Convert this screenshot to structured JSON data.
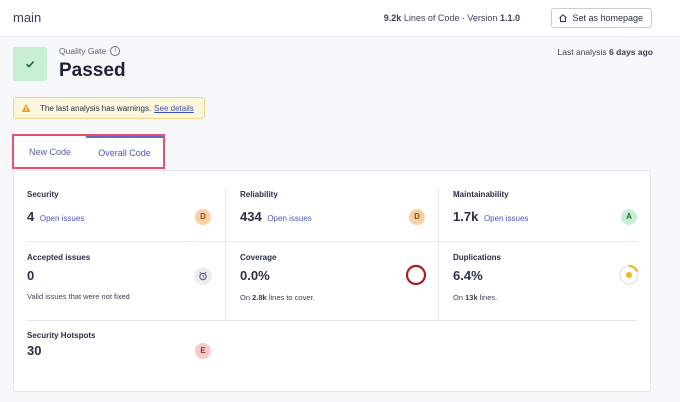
{
  "header": {
    "branch": "main",
    "loc_value": "9.2k",
    "loc_label": "Lines of Code",
    "separator": "·",
    "version_label": "Version",
    "version_value": "1.1.0",
    "homepage_button": "Set as homepage"
  },
  "quality_gate": {
    "label": "Quality Gate",
    "status": "Passed",
    "last_analysis_label": "Last analysis",
    "last_analysis_value": "6 days ago"
  },
  "warning": {
    "text": "The last analysis has warnings.",
    "link": "See details"
  },
  "tabs": {
    "new_code": "New Code",
    "overall_code": "Overall Code"
  },
  "metrics": {
    "security": {
      "title": "Security",
      "value": "4",
      "sub": "Open issues",
      "rating": "D"
    },
    "reliability": {
      "title": "Reliability",
      "value": "434",
      "sub": "Open issues",
      "rating": "D"
    },
    "maintainability": {
      "title": "Maintainability",
      "value": "1.7k",
      "sub": "Open issues",
      "rating": "A"
    },
    "accepted": {
      "title": "Accepted issues",
      "value": "0",
      "note": "Valid issues that were not fixed"
    },
    "coverage": {
      "title": "Coverage",
      "value": "0.0%",
      "note_prefix": "On",
      "note_value": "2.8k",
      "note_suffix": "lines to cover.",
      "percent": 0
    },
    "duplications": {
      "title": "Duplications",
      "value": "6.4%",
      "note_prefix": "On",
      "note_value": "13k",
      "note_suffix": "lines.",
      "percent": 6.4
    },
    "hotspots": {
      "title": "Security Hotspots",
      "value": "30",
      "rating": "E"
    }
  },
  "colors": {
    "rating_d_bg": "#fbd0a6",
    "rating_d_fg": "#8a4b12",
    "rating_a_bg": "#c8efd4",
    "rating_a_fg": "#1f6b35",
    "rating_e_bg": "#f7cbc9",
    "rating_e_fg": "#9b2d25",
    "coverage_ring": "#a71f1f",
    "duplication_ring": "#e9b91a",
    "accent": "#4b57b8"
  }
}
